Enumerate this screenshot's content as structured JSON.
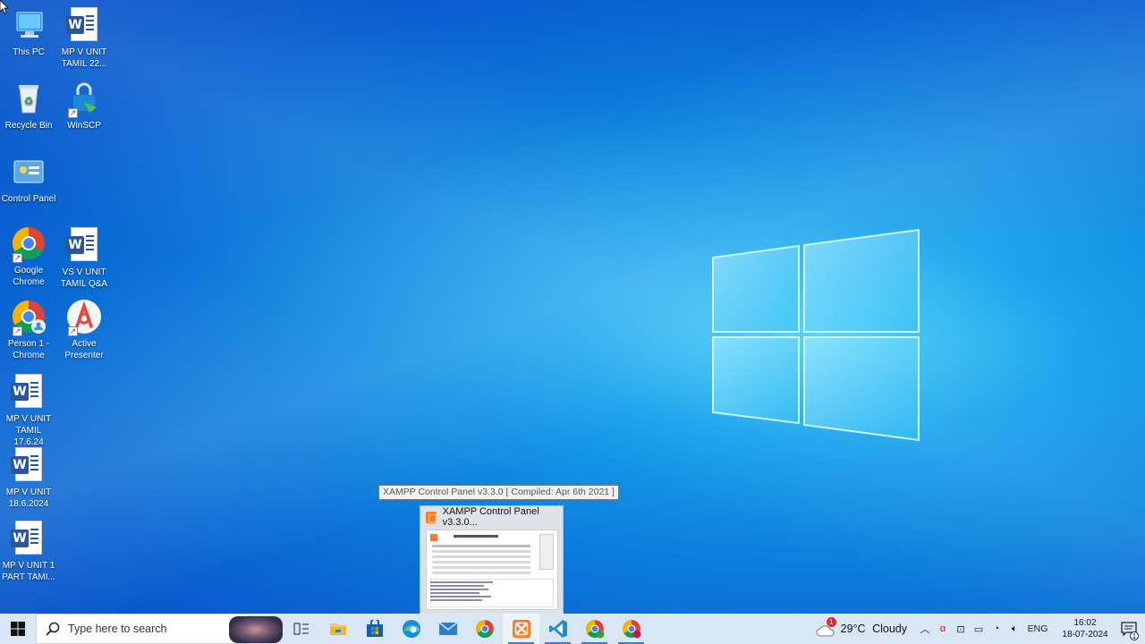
{
  "desktop": {
    "icons": [
      {
        "label": "This PC",
        "icon": "computer-icon"
      },
      {
        "label": "MP V UNIT TAMIL 22...",
        "icon": "word-document-icon"
      },
      {
        "label": "Recycle Bin",
        "icon": "recycle-bin-icon"
      },
      {
        "label": "WinSCP",
        "icon": "winscp-icon"
      },
      {
        "label": "Control Panel",
        "icon": "control-panel-icon"
      },
      {
        "label": "Google Chrome",
        "icon": "chrome-icon"
      },
      {
        "label": "VS V UNIT TAMIL Q&A",
        "icon": "word-document-icon"
      },
      {
        "label": "Person 1 - Chrome",
        "icon": "chrome-profile-icon"
      },
      {
        "label": "Active Presenter",
        "icon": "activepresenter-icon"
      },
      {
        "label": "MP V UNIT TAMIL 17.6.24",
        "icon": "word-document-icon"
      },
      {
        "label": "MP V UNIT 18.6.2024",
        "icon": "word-document-icon"
      },
      {
        "label": "MP V UNIT 1 PART TAMI...",
        "icon": "word-document-icon"
      }
    ]
  },
  "tooltip": {
    "text": "XAMPP Control Panel v3.3.0   [ Compiled: Apr 6th 2021 ]"
  },
  "thumbnail": {
    "title": "XAMPP Control Panel v3.3.0..."
  },
  "taskbar": {
    "search_placeholder": "Type here to search",
    "pinned": [
      "task-view-icon",
      "file-explorer-icon",
      "microsoft-store-icon",
      "edge-icon",
      "mail-icon",
      "chrome-icon",
      "xampp-icon",
      "vscode-icon",
      "chrome-profile-icon",
      "chrome-profile-icon"
    ],
    "weather": {
      "temp": "29°C",
      "condition": "Cloudy",
      "badge": "1"
    },
    "language": "ENG",
    "time": "16:02",
    "date": "18-07-2024",
    "notification_count": "1"
  },
  "colors": {
    "accent": "#3c7bd6",
    "word": "#2b579a",
    "xampp": "#fb7a24"
  }
}
